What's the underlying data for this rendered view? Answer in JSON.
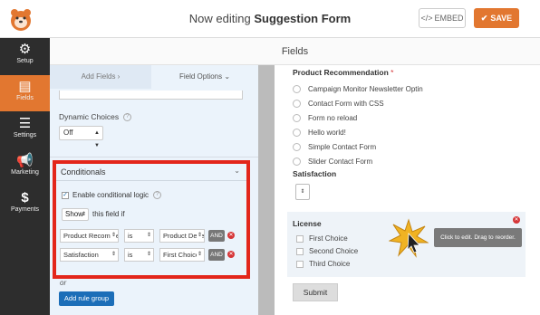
{
  "header": {
    "title_prefix": "Now editing",
    "form_name": "Suggestion Form",
    "embed_label": "EMBED",
    "save_label": "SAVE"
  },
  "sidebar": {
    "items": [
      {
        "label": "Setup",
        "icon": "gear-icon"
      },
      {
        "label": "Fields",
        "icon": "fields-list-icon"
      },
      {
        "label": "Settings",
        "icon": "sliders-icon"
      },
      {
        "label": "Marketing",
        "icon": "megaphone-icon"
      },
      {
        "label": "Payments",
        "icon": "dollar-icon"
      }
    ]
  },
  "fields_header": "Fields",
  "panel": {
    "tabs": [
      {
        "label": "Add Fields",
        "icon": "chevron-right-icon"
      },
      {
        "label": "Field Options",
        "icon": "chevron-down-icon"
      }
    ],
    "dynamic_choices": {
      "label": "Dynamic Choices",
      "value": "Off"
    },
    "conditionals": {
      "title": "Conditionals",
      "enable_label": "Enable conditional logic",
      "enabled": true,
      "show_value": "Show",
      "show_suffix": "this field if",
      "rules": [
        {
          "field": "Product Recommendation",
          "operator": "is",
          "value": "Product Development",
          "and_label": "AND"
        },
        {
          "field": "Satisfaction",
          "operator": "is",
          "value": "First Choice",
          "and_label": "AND"
        }
      ]
    },
    "or_label": "or",
    "add_rule_group_label": "Add rule group"
  },
  "preview": {
    "product_recommendation": {
      "label": "Product Recommendation",
      "required_mark": "*",
      "options": [
        "Campaign Monitor Newsletter Optin",
        "Contact Form with CSS",
        "Form no reload",
        "Hello world!",
        "Simple Contact Form",
        "Slider Contact Form"
      ]
    },
    "satisfaction": {
      "label": "Satisfaction"
    },
    "license": {
      "label": "License",
      "options": [
        "First Choice",
        "Second Choice",
        "Third Choice"
      ],
      "tooltip": "Click to edit. Drag to reorder."
    },
    "submit_label": "Submit"
  },
  "colors": {
    "accent": "#e27730",
    "sidebar_bg": "#2d2d2d",
    "highlight_border": "#e3261b",
    "button_blue": "#1c6eb8"
  }
}
